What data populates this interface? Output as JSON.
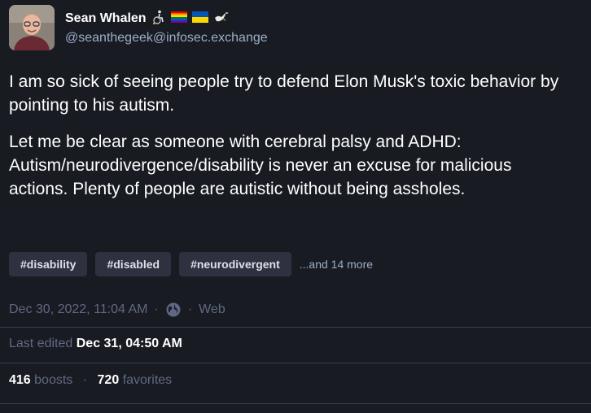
{
  "account": {
    "display_name": "Sean Whalen",
    "handle": "@seanthegeek@infosec.exchange",
    "name_emojis": [
      "wheelchair-person-icon",
      "rainbow-flag-icon",
      "ukraine-flag-icon",
      "dove-icon"
    ]
  },
  "post": {
    "paragraphs": [
      "I am so sick of seeing people try to defend Elon Musk's toxic behavior by pointing to his autism.",
      "Let me be clear as someone with cerebral palsy and ADHD: Autism/neurodivergence/disability is never an excuse for malicious actions. Plenty of people are autistic without being assholes."
    ],
    "hashtags": [
      "#disability",
      "#disabled",
      "#neurodivergent"
    ],
    "more_tags": "...and 14 more"
  },
  "meta": {
    "date": "Dec 30, 2022, 11:04 AM",
    "dot": "·",
    "visibility_icon": "globe-icon",
    "application": "Web"
  },
  "edited": {
    "label": "Last edited",
    "date": "Dec 31, 04:50 AM"
  },
  "stats": {
    "boosts_count": "416",
    "boosts_label": "boosts",
    "favorites_count": "720",
    "favorites_label": "favorites"
  },
  "colors": {
    "background": "#191b22",
    "text": "#ffffff",
    "secondary": "#9baec8",
    "muted": "#606984",
    "tag_bg": "#2f3140",
    "divider": "#393f4f"
  }
}
